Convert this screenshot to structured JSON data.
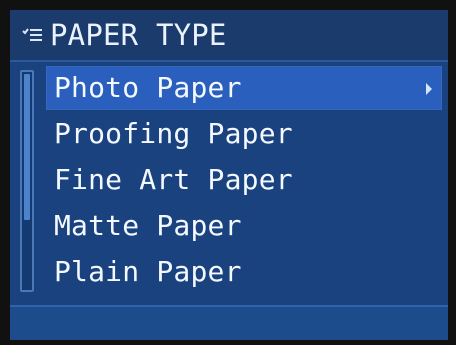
{
  "header": {
    "title": "PAPER TYPE",
    "icon": "menu-list-icon"
  },
  "menu": {
    "items": [
      {
        "label": "Photo Paper",
        "selected": true,
        "has_submenu": true
      },
      {
        "label": "Proofing Paper",
        "selected": false
      },
      {
        "label": "Fine Art Paper",
        "selected": false
      },
      {
        "label": "Matte Paper",
        "selected": false
      },
      {
        "label": "Plain Paper",
        "selected": false
      }
    ]
  },
  "colors": {
    "screen": "#19427f",
    "header": "#1b3b6c",
    "selected": "#2a5fbd",
    "text": "#f4f8ff"
  }
}
